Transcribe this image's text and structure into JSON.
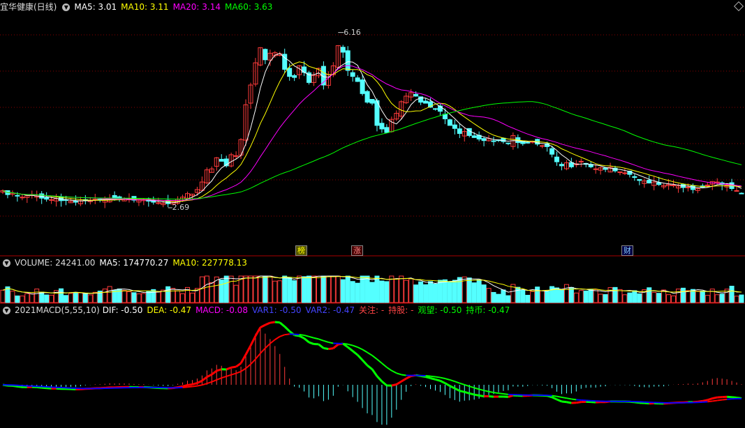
{
  "price_panel": {
    "title": "宜华健康(日线)",
    "ma5_label": "MA5: 3.01",
    "ma10_label": "MA10: 3.11",
    "ma20_label": "MA20: 3.14",
    "ma60_label": "MA60: 3.63",
    "high_label": "6.16",
    "low_label": "2.69",
    "markers": [
      "榜",
      "涨",
      "财"
    ]
  },
  "volume_panel": {
    "vol_label": "VOLUME: 24241.00",
    "ma5_label": "MA5: 174770.27",
    "ma10_label": "MA10: 227778.13"
  },
  "macd_panel": {
    "title": "2021MACD(5,55,10)",
    "dif_label": "DIF: -0.50",
    "dea_label": "DEA: -0.47",
    "macd_label": "MACD: -0.08",
    "var1_label": "VAR1: -0.50",
    "var2_label": "VAR2: -0.47",
    "guanzhu_label": "关注: -",
    "chigu_label": "持股: -",
    "guanwang_label": "观望: -0.50",
    "chibi_label": "持币: -0.47"
  },
  "colors": {
    "up": "#ff3b3b",
    "down": "#54ffff",
    "ma5": "#ffffff",
    "ma10": "#ffff00",
    "ma20": "#ff00ff",
    "ma60": "#00ff00",
    "grid": "#8b0000",
    "dif_up": "#ff0000",
    "dif_down": "#00ff00",
    "dea": "#0000ff"
  },
  "chart_data": {
    "type": "candlestick",
    "closes": [
      3.03,
      2.95,
      2.98,
      2.92,
      2.9,
      2.93,
      2.95,
      2.92,
      2.88,
      2.86,
      2.85,
      2.87,
      2.83,
      2.84,
      2.82,
      2.8,
      2.83,
      2.85,
      2.84,
      2.86,
      2.84,
      2.86,
      2.88,
      2.85,
      2.87,
      2.86,
      2.86,
      2.84,
      2.84,
      2.85,
      2.82,
      2.8,
      2.79,
      2.78,
      2.77,
      2.81,
      2.86,
      2.9,
      2.97,
      2.96,
      3.05,
      3.2,
      3.44,
      3.46,
      3.68,
      3.61,
      3.52,
      3.74,
      3.72,
      4.04,
      4.73,
      5.12,
      5.56,
      5.86,
      5.62,
      5.75,
      5.76,
      5.74,
      5.43,
      5.29,
      5.27,
      5.5,
      5.37,
      5.17,
      5.31,
      5.45,
      5.12,
      5.33,
      5.5,
      5.9,
      5.77,
      5.41,
      5.29,
      5.19,
      4.95,
      4.78,
      4.76,
      4.32,
      4.25,
      4.18,
      4.44,
      4.56,
      4.79,
      4.9,
      4.97,
      4.9,
      4.78,
      4.76,
      4.68,
      4.65,
      4.6,
      4.45,
      4.32,
      4.26,
      4.16,
      4.2,
      4.12,
      4.08,
      4.05,
      4.02,
      4.06,
      4.0,
      4.02,
      4.0,
      3.96,
      4.12,
      3.98,
      3.96,
      3.98,
      4.0,
      3.95,
      3.92,
      3.9,
      3.75,
      3.6,
      3.52,
      3.58,
      3.5,
      3.56,
      3.61,
      3.55,
      3.5,
      3.46,
      3.48,
      3.45,
      3.49,
      3.42,
      3.4,
      3.38,
      3.35,
      3.29,
      3.23,
      3.22,
      3.18,
      3.2,
      3.15,
      3.13,
      3.15,
      3.14,
      3.12,
      3.09,
      3.1,
      3.05,
      3.07,
      3.1,
      3.14,
      3.21,
      3.2,
      3.15,
      3.14,
      3.07,
      3.03,
      2.97
    ],
    "price_range": [
      2.0,
      6.5
    ],
    "high": 6.16,
    "low": 2.69,
    "ma5": 3.01,
    "ma10": 3.11,
    "ma20": 3.14,
    "ma60": 3.63,
    "volume": 24241.0,
    "vol_ma5": 174770.27,
    "vol_ma10": 227778.13,
    "dif": -0.5,
    "dea": -0.47,
    "macd": -0.08
  }
}
